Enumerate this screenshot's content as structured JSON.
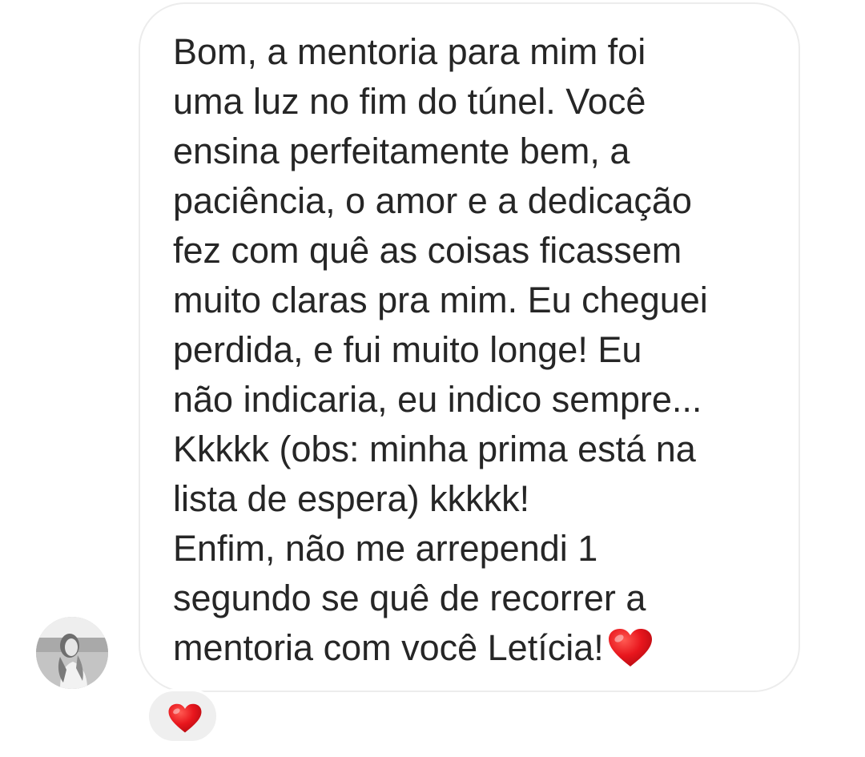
{
  "message": {
    "lines": [
      "Bom, a mentoria para mim foi",
      "uma luz no fim do túnel. Você",
      "ensina perfeitamente bem, a",
      "paciência, o amor e a dedicação",
      "fez com quê as coisas ficassem",
      "muito claras pra mim. Eu cheguei",
      "perdida, e fui muito longe!  Eu",
      "não indicaria, eu indico sempre...",
      "Kkkkk (obs: minha prima está na",
      "lista de espera) kkkkk!",
      " Enfim, não me arrependi 1",
      "segundo se quê de recorrer a",
      "mentoria com você Letícia!"
    ],
    "end_emoji": "red-heart-icon"
  },
  "sender": {
    "avatar": "profile-photo"
  },
  "reaction": {
    "emoji": "red-heart-icon"
  },
  "colors": {
    "text": "#262626",
    "bubble_border": "#ececec",
    "reaction_background": "#efefef",
    "heart": "#e8161d"
  }
}
